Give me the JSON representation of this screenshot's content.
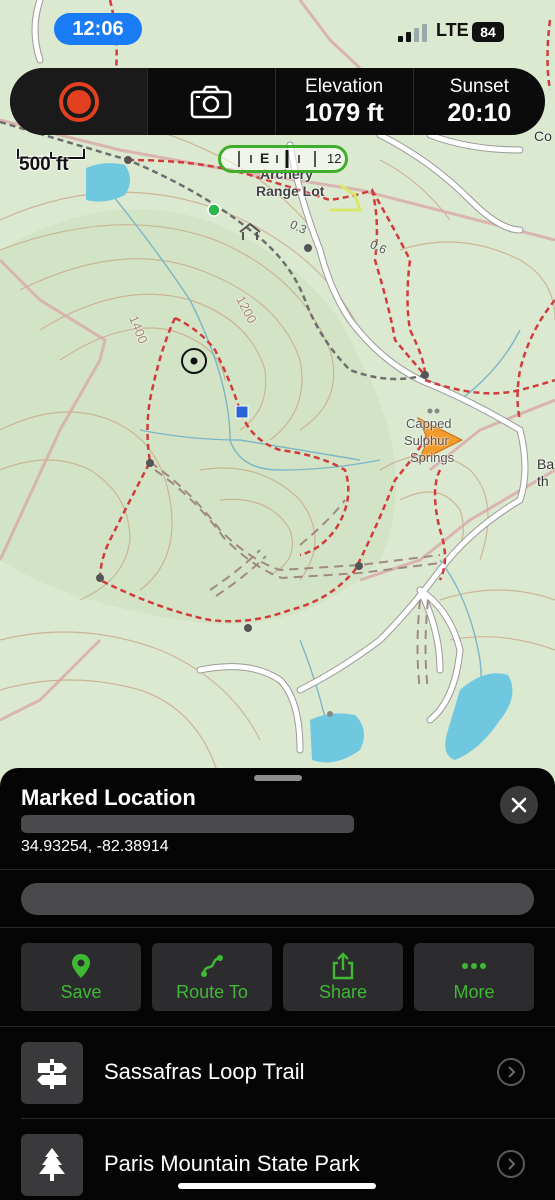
{
  "status_bar": {
    "time": "12:06",
    "network": "LTE",
    "battery": "84"
  },
  "toolbar": {
    "elevation_label": "Elevation",
    "elevation_value": "1079 ft",
    "sunset_label": "Sunset",
    "sunset_value": "20:10"
  },
  "map": {
    "scale_label": "500 ft",
    "compass_e": "E",
    "compass_12": "12",
    "labels": {
      "archery": "Archery",
      "range_lot": "Range Lot",
      "d03": "0.3",
      "d06": "0.6",
      "c1200": "1200",
      "c1400": "1400",
      "capped": "Capped",
      "sulphur": "Sulphur",
      "springs": "Springs",
      "ba": "Ba",
      "th": "th",
      "co": "Co"
    }
  },
  "sheet": {
    "title": "Marked Location",
    "coordinates": "34.93254, -82.38914",
    "actions": [
      {
        "label": "Save",
        "icon": "pin-icon"
      },
      {
        "label": "Route To",
        "icon": "route-icon"
      },
      {
        "label": "Share",
        "icon": "share-icon"
      },
      {
        "label": "More",
        "icon": "more-icon"
      }
    ],
    "rows": [
      {
        "label": "Sassafras Loop Trail",
        "icon": "trail-sign-icon"
      },
      {
        "label": "Paris Mountain State Park",
        "icon": "tree-icon"
      }
    ]
  },
  "colors": {
    "accent_green": "#3fb934",
    "record_red": "#e3401f",
    "trail_red": "#d23b3b",
    "map_bg": "#dbe9d0"
  }
}
